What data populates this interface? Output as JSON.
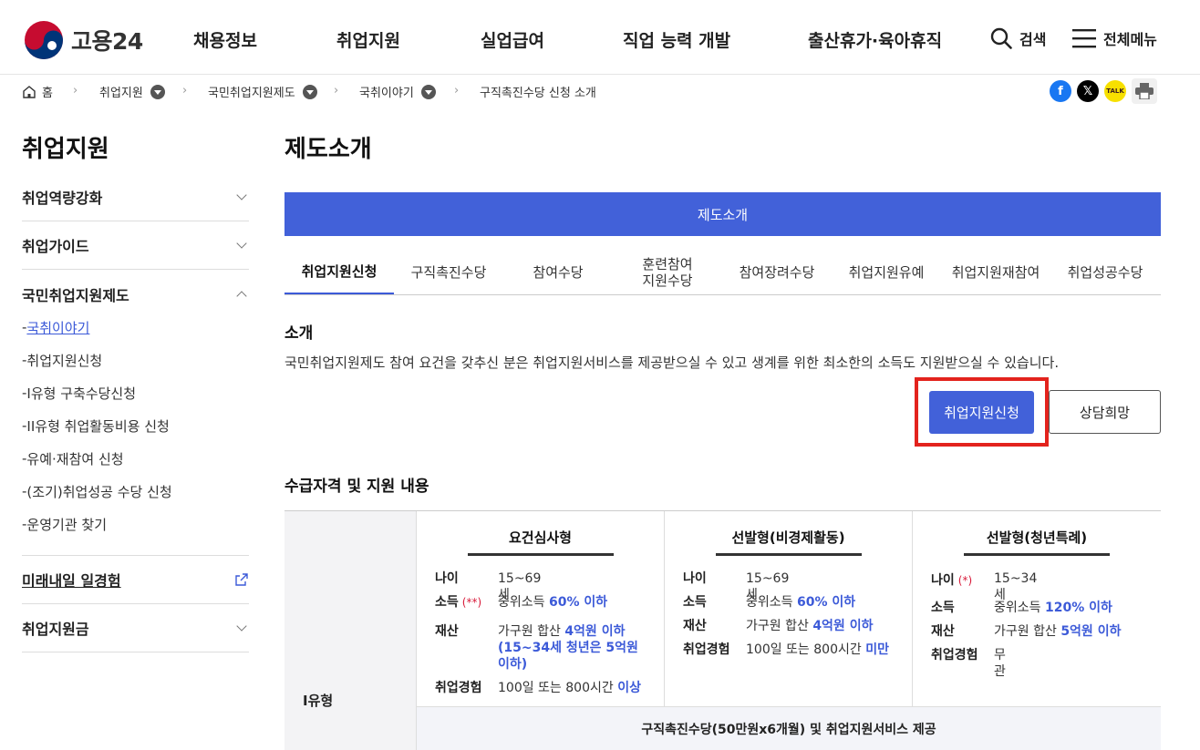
{
  "header": {
    "logo_text": "고용24",
    "nav": [
      "채용정보",
      "취업지원",
      "실업급여",
      "직업 능력 개발",
      "출산휴가·육아휴직"
    ],
    "search_label": "검색",
    "menu_label": "전체메뉴"
  },
  "breadcrumb": {
    "home": "홈",
    "items": [
      "취업지원",
      "국민취업지원제도",
      "국취이야기",
      "구직촉진수당 신청 소개"
    ]
  },
  "share": {
    "facebook": "f",
    "x": "𝕏",
    "kakao": "TALK"
  },
  "sidebar": {
    "title": "취업지원",
    "items": [
      "취업역량강화",
      "취업가이드"
    ],
    "open_item": "국민취업지원제도",
    "sub_items": [
      "국취이야기",
      "취업지원신청",
      "I유형 구축수당신청",
      "II유형 취업활동비용 신청",
      "유예·재참여 신청",
      "(조기)취업성공 수당 신청",
      "운영기관 찾기"
    ],
    "sub_prefix": "-",
    "after_items": [
      "미래내일 일경험",
      "취업지원금"
    ]
  },
  "main": {
    "title": "제도소개",
    "banner": "제도소개",
    "tabs": [
      "취업지원신청",
      "구직촉진수당",
      "참여수당",
      "훈련참여\n지원수당",
      "참여장려수당",
      "취업지원유예",
      "취업지원재참여",
      "취업성공수당"
    ],
    "intro_heading": "소개",
    "intro_text": "국민취업지원제도 참여 요건을 갖추신 분은 취업지원서비스를 제공받으실 수 있고 생계를 위한 최소한의 소득도 지원받으실 수 있습니다.",
    "apply_button": "취업지원신청",
    "consult_button": "상담희망",
    "eligibility_heading": "수급자격 및 지원 내용"
  },
  "table": {
    "row_label": "I유형",
    "columns": [
      {
        "header": "요건심사형",
        "rows": [
          {
            "k": "나이",
            "req": "",
            "v": "15~69세",
            "h": ""
          },
          {
            "k": "소득",
            "req": "(**)",
            "v": "중위소득 ",
            "h": "60% 이하"
          },
          {
            "k": "재산",
            "req": "",
            "v": "가구원 합산 ",
            "h": "4억원 이하",
            "extra": "(15~34세 청년은 5억원 이하)"
          },
          {
            "k": "취업경험",
            "req": "",
            "v": "100일 또는 800시간 ",
            "h": "이상"
          }
        ]
      },
      {
        "header": "선발형(비경제활동)",
        "rows": [
          {
            "k": "나이",
            "req": "",
            "v": "15~69세",
            "h": ""
          },
          {
            "k": "소득",
            "req": "",
            "v": "중위소득 ",
            "h": "60% 이하"
          },
          {
            "k": "재산",
            "req": "",
            "v": "가구원 합산 ",
            "h": "4억원 이하"
          },
          {
            "k": "취업경험",
            "req": "",
            "v": "100일 또는 800시간 ",
            "h": "미만"
          }
        ]
      },
      {
        "header": "선발형(청년특례)",
        "rows": [
          {
            "k": "나이",
            "req": "(*)",
            "v": "15~34세",
            "h": ""
          },
          {
            "k": "소득",
            "req": "",
            "v": "중위소득 ",
            "h": "120% 이하"
          },
          {
            "k": "재산",
            "req": "",
            "v": "가구원 합산 ",
            "h": "5억원 이하"
          },
          {
            "k": "취업경험",
            "req": "",
            "v": "무관",
            "h": ""
          }
        ]
      }
    ],
    "footer": "구직촉진수당(50만원x6개월) 및 취업지원서비스 제공"
  },
  "colors": {
    "primary": "#4261d9",
    "highlight_box": "#e3231d",
    "required_mark": "#d81b3a"
  }
}
